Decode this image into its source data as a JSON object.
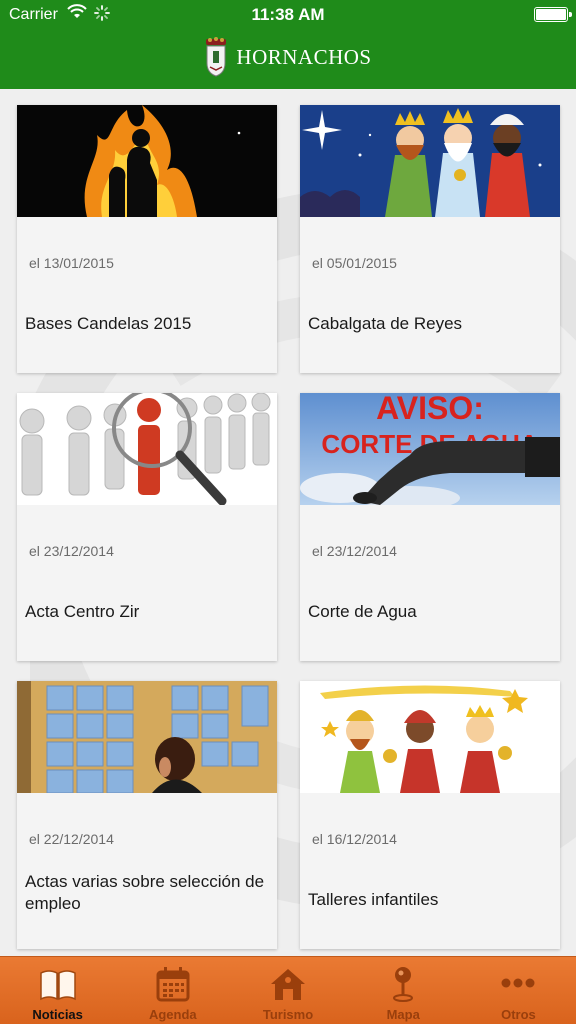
{
  "status_bar": {
    "carrier": "Carrier",
    "time": "11:38 AM"
  },
  "header": {
    "title": "HORNACHOS"
  },
  "news": [
    {
      "date": "el 13/01/2015",
      "title": "Bases Candelas 2015",
      "image": "bonfire-image"
    },
    {
      "date": "el 05/01/2015",
      "title": "Cabalgata de Reyes",
      "image": "three-kings-image"
    },
    {
      "date": "el 23/12/2014",
      "title": "Acta Centro Zir",
      "image": "magnifier-figures-image"
    },
    {
      "date": "el 23/12/2014",
      "title": "Corte de Agua",
      "image": "water-tap-image",
      "image_text": {
        "line1": "AVISO:",
        "line2": "CORTE DE AGUA"
      }
    },
    {
      "date": "el 22/12/2014",
      "title": "Actas varias sobre selección de empleo",
      "image": "notice-board-image"
    },
    {
      "date": "el 16/12/2014",
      "title": "Talleres infantiles",
      "image": "kings-cartoon-image"
    }
  ],
  "tabs": [
    {
      "label": "Noticias",
      "icon": "book-icon",
      "active": true
    },
    {
      "label": "Agenda",
      "icon": "calendar-icon",
      "active": false
    },
    {
      "label": "Turismo",
      "icon": "house-icon",
      "active": false
    },
    {
      "label": "Mapa",
      "icon": "map-pin-icon",
      "active": false
    },
    {
      "label": "Otros",
      "icon": "more-icon",
      "active": false
    }
  ],
  "colors": {
    "header_green": "#1f8b1a",
    "tabbar_orange": "#e06d28",
    "tab_label_inactive": "#9a3f0c"
  }
}
